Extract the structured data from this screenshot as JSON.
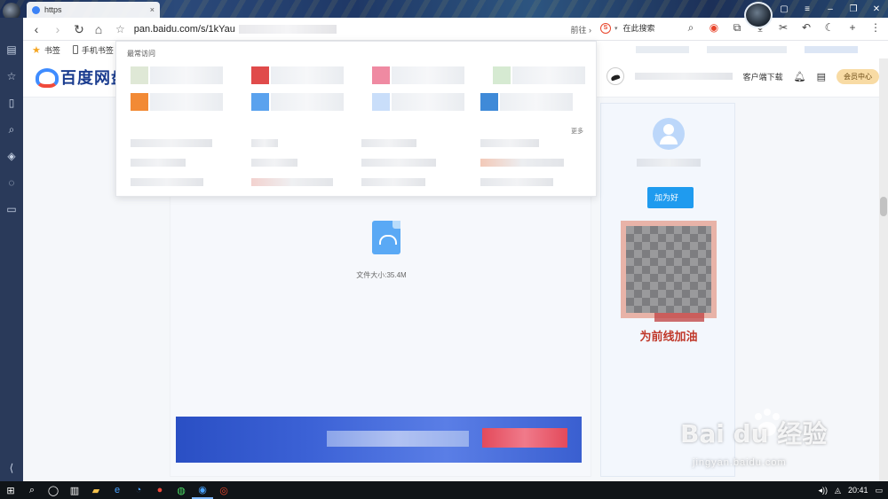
{
  "browser": {
    "tab_title": "https",
    "address": "pan.baidu.com/s/1kYau",
    "goto_label": "前往",
    "search_placeholder": "在此搜索",
    "bookmarks": [
      "书签",
      "手机书签"
    ]
  },
  "dropdown": {
    "title": "最常访问",
    "more_label": "更多"
  },
  "pan": {
    "logo_text": "百度网盘",
    "client_download": "客户端下载",
    "vip_center": "会员中心",
    "file_size_label": "文件大小:35.4M",
    "follow_label": "加为好",
    "slogan": "为前线加油"
  },
  "watermark": {
    "brand": "Bai du 经验",
    "url": "jingyan.baidu.com"
  },
  "taskbar": {
    "time": "20:41"
  },
  "colors": {
    "accent": "#3f8cff",
    "follow": "#1f9bef",
    "vip": "#f8dba4",
    "slogan": "#c0392b"
  }
}
